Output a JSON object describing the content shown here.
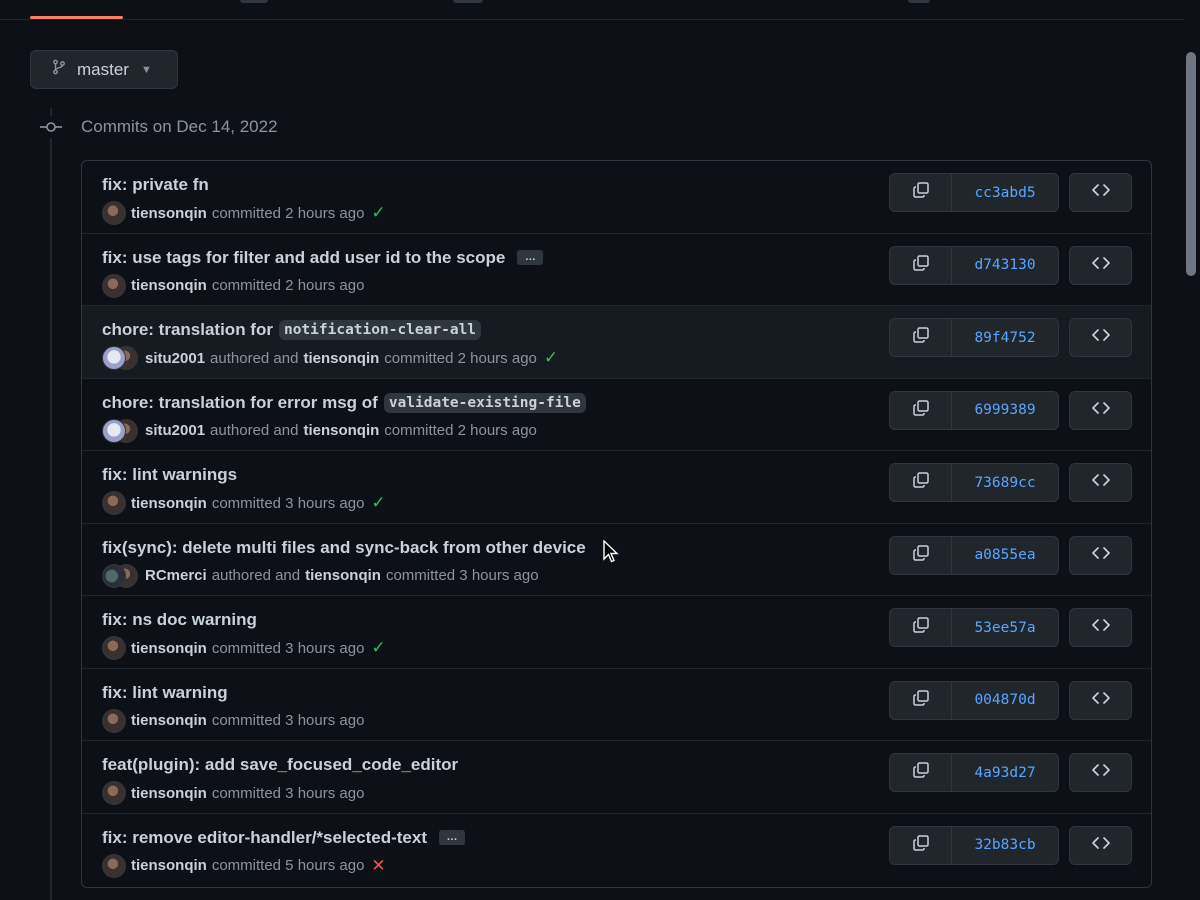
{
  "branch": {
    "name": "master"
  },
  "timeline": {
    "date_heading": "Commits on Dec 14, 2022"
  },
  "colors": {
    "accent_underline": "#f78166",
    "sha_link": "#58a6ff",
    "success": "#3fb950",
    "failure": "#f85149"
  },
  "commits": [
    {
      "title": "fix: private fn",
      "avatar": "tiensonqin",
      "meta_text": "committed 2 hours ago",
      "author": "tiensonqin",
      "status": "success",
      "sha": "cc3abd5"
    },
    {
      "title": "fix: use tags for filter and add user id to the scope",
      "has_ellipsis": true,
      "ellipsis": "…",
      "author": "tiensonqin",
      "meta_text": "committed 2 hours ago",
      "status": "none",
      "sha": "d743130"
    },
    {
      "title": "chore: translation for ",
      "code": "notification-clear-all",
      "author": "situ2001",
      "authored_text": "authored and",
      "committer": "tiensonqin",
      "meta_text": "committed 2 hours ago",
      "status": "success",
      "sha": "89f4752"
    },
    {
      "title": "chore: translation for error msg of ",
      "code": "validate-existing-file",
      "author": "situ2001",
      "authored_text": "authored and",
      "committer": "tiensonqin",
      "meta_text": "committed 2 hours ago",
      "status": "none",
      "sha": "6999389"
    },
    {
      "title": "fix: lint warnings",
      "author": "tiensonqin",
      "meta_text": "committed 3 hours ago",
      "status": "success",
      "sha": "73689cc"
    },
    {
      "title": "fix(sync): delete multi files and sync-back from other device",
      "author": "RCmerci",
      "authored_text": "authored and",
      "committer": "tiensonqin",
      "meta_text": "committed 3 hours ago",
      "status": "none",
      "sha": "a0855ea"
    },
    {
      "title": "fix: ns doc warning",
      "author": "tiensonqin",
      "meta_text": "committed 3 hours ago",
      "status": "success",
      "sha": "53ee57a"
    },
    {
      "title": "fix: lint warning",
      "author": "tiensonqin",
      "meta_text": "committed 3 hours ago",
      "status": "none",
      "sha": "004870d"
    },
    {
      "title": "feat(plugin): add save_focused_code_editor",
      "author": "tiensonqin",
      "meta_text": "committed 3 hours ago",
      "status": "none",
      "sha": "4a93d27"
    },
    {
      "title": "fix: remove editor-handler/*selected-text",
      "has_ellipsis": true,
      "ellipsis": "…",
      "author": "tiensonqin",
      "meta_text": "committed 5 hours ago",
      "status": "failure",
      "sha": "32b83cb"
    }
  ]
}
